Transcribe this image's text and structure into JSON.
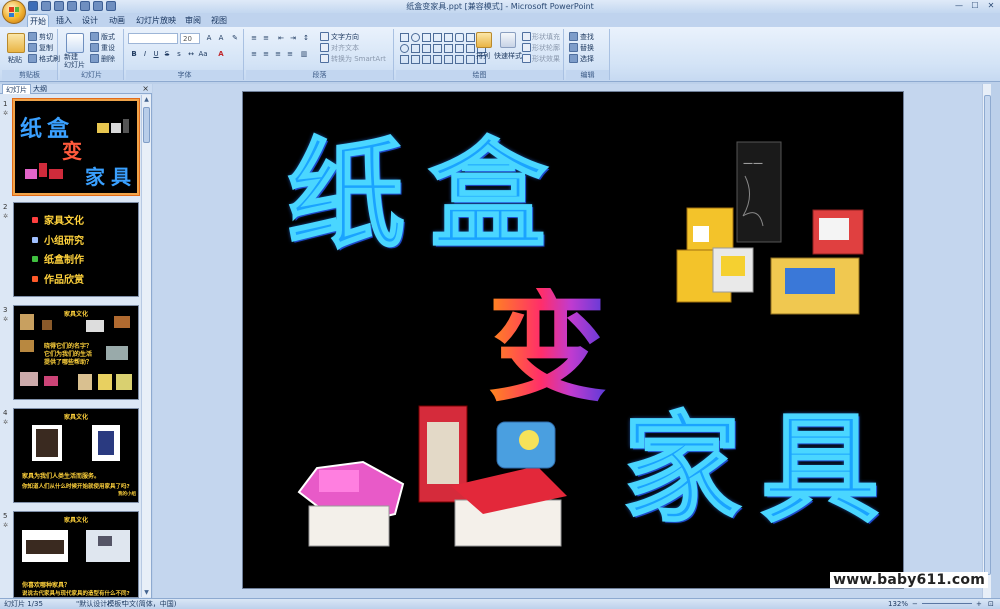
{
  "window": {
    "title": "纸盒变家具.ppt [兼容模式] - Microsoft PowerPoint",
    "controls": [
      "—",
      "☐",
      "✕"
    ]
  },
  "ribbon_tabs": [
    "开始",
    "插入",
    "设计",
    "动画",
    "幻灯片放映",
    "审阅",
    "视图"
  ],
  "ribbon": {
    "clipboard": {
      "label": "剪贴板",
      "paste": "粘贴",
      "cut": "剪切",
      "copy": "复制",
      "format_painter": "格式刷"
    },
    "slides": {
      "label": "幻灯片",
      "new_slide": "新建\n幻灯片",
      "layout": "版式",
      "reset": "重设",
      "delete": "删除"
    },
    "font": {
      "label": "字体",
      "font_name": "",
      "font_size": "20"
    },
    "paragraph": {
      "label": "段落",
      "text_direction": "文字方向",
      "align_text": "对齐文本",
      "smartart": "转换为 SmartArt"
    },
    "drawing": {
      "label": "绘图",
      "arrange": "排列",
      "quick_styles": "快速样式",
      "fill": "形状填充",
      "outline": "形状轮廓",
      "effects": "形状效果"
    },
    "editing": {
      "label": "编辑",
      "find": "查找",
      "replace": "替换",
      "select": "选择"
    }
  },
  "panel": {
    "tabs": [
      "幻灯片",
      "大纲"
    ],
    "close": "×",
    "slide_numbers": [
      "1",
      "2",
      "3",
      "4",
      "5"
    ],
    "thumb1": {
      "chars": [
        "纸",
        "盒",
        "变",
        "家",
        "具"
      ]
    },
    "thumb2": {
      "items": [
        "家具文化",
        "小组研究",
        "纸盒制作",
        "作品欣赏"
      ]
    },
    "thumb3": {
      "title": "家具文化",
      "text": [
        "晓得它们的名字？",
        "它们为我们的生活",
        "提供了哪些帮助？"
      ]
    },
    "thumb4": {
      "title": "家具文化",
      "text": [
        "家具为我们人类生活而服务。",
        "你知道人们从什么时候开始就使用家具了吗?"
      ],
      "note": "我的小组"
    },
    "thumb5": {
      "title": "家具文化",
      "text": [
        "你喜欢哪种家具？",
        "说说古代家具与现代家具的造型有什么不同?"
      ]
    }
  },
  "slide": {
    "title_chars": [
      "纸",
      "盒"
    ],
    "middle_char": "变",
    "bottom_chars": [
      "家",
      "具"
    ]
  },
  "status": {
    "slide_info": "幻灯片 1/35",
    "theme": "\"默认设计模板\"",
    "language": "中文(简体，中国)",
    "zoom": "132%"
  },
  "watermark": "www.baby611.com",
  "colors": {
    "accent_blue": "#1aa3ff",
    "orange": "#ff8b1a",
    "selection": "#f0a44a"
  }
}
